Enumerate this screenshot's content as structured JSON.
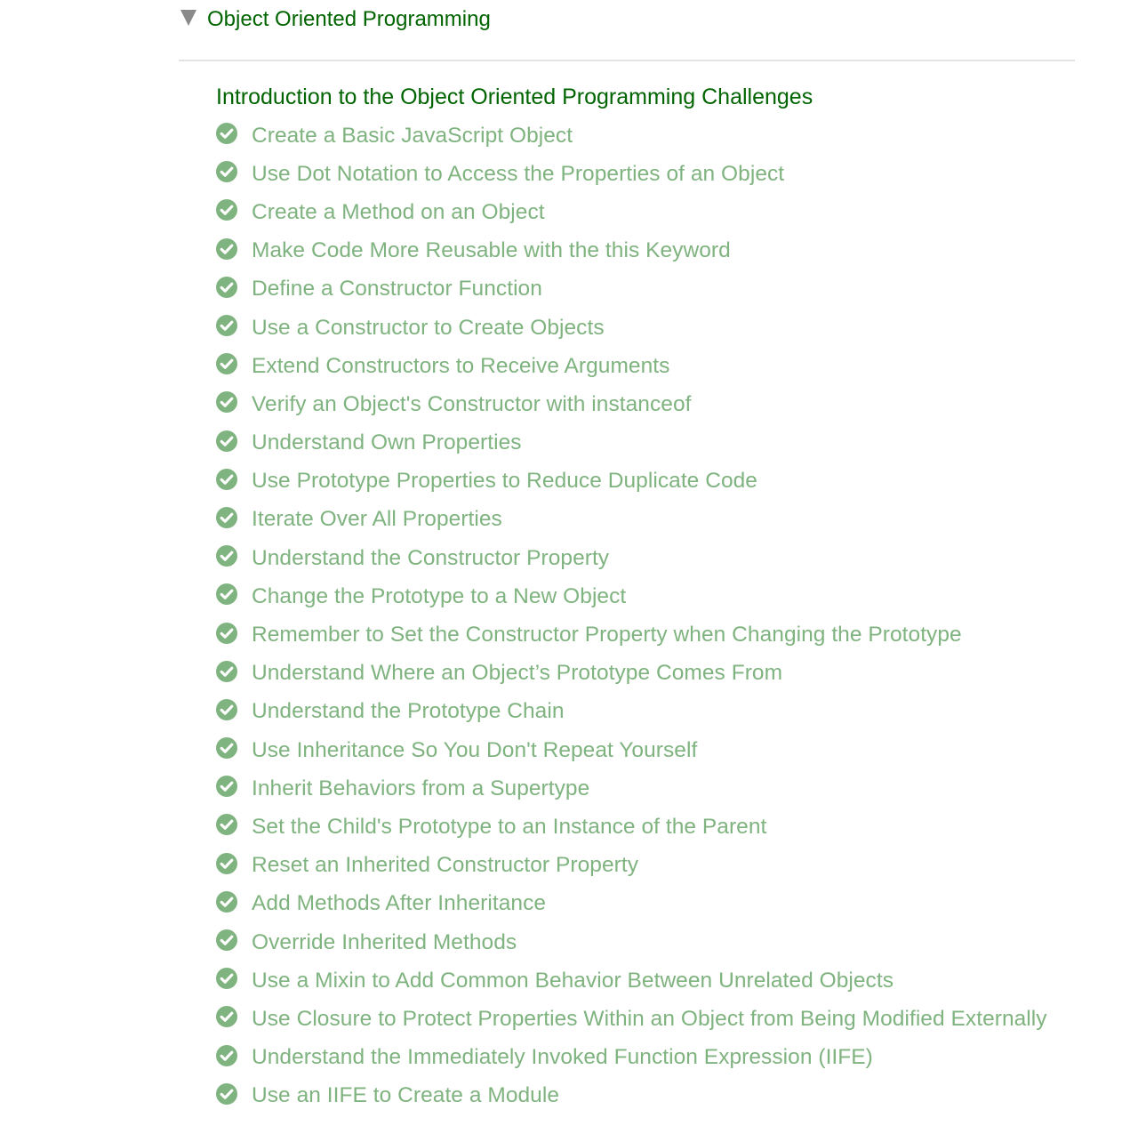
{
  "section": {
    "title": "Object Oriented Programming",
    "expanded_icon": "caret-down-icon",
    "intro_link": "Introduction to the Object Oriented Programming Challenges"
  },
  "colors": {
    "section_title": "#006400",
    "completed_challenge": "#7fb37f",
    "check_icon": "#7fb37f",
    "caret": "#8a8a8a",
    "divider": "#e3e3e3"
  },
  "challenges": [
    {
      "label": "Create a Basic JavaScript Object",
      "completed": true
    },
    {
      "label": "Use Dot Notation to Access the Properties of an Object",
      "completed": true
    },
    {
      "label": "Create a Method on an Object",
      "completed": true
    },
    {
      "label": "Make Code More Reusable with the this Keyword",
      "completed": true
    },
    {
      "label": "Define a Constructor Function",
      "completed": true
    },
    {
      "label": "Use a Constructor to Create Objects",
      "completed": true
    },
    {
      "label": "Extend Constructors to Receive Arguments",
      "completed": true
    },
    {
      "label": "Verify an Object's Constructor with instanceof",
      "completed": true
    },
    {
      "label": "Understand Own Properties",
      "completed": true
    },
    {
      "label": "Use Prototype Properties to Reduce Duplicate Code",
      "completed": true
    },
    {
      "label": "Iterate Over All Properties",
      "completed": true
    },
    {
      "label": "Understand the Constructor Property",
      "completed": true
    },
    {
      "label": "Change the Prototype to a New Object",
      "completed": true
    },
    {
      "label": "Remember to Set the Constructor Property when Changing the Prototype",
      "completed": true
    },
    {
      "label": "Understand Where an Object’s Prototype Comes From",
      "completed": true
    },
    {
      "label": "Understand the Prototype Chain",
      "completed": true
    },
    {
      "label": "Use Inheritance So You Don't Repeat Yourself",
      "completed": true
    },
    {
      "label": "Inherit Behaviors from a Supertype",
      "completed": true
    },
    {
      "label": "Set the Child's Prototype to an Instance of the Parent",
      "completed": true
    },
    {
      "label": "Reset an Inherited Constructor Property",
      "completed": true
    },
    {
      "label": "Add Methods After Inheritance",
      "completed": true
    },
    {
      "label": "Override Inherited Methods",
      "completed": true
    },
    {
      "label": "Use a Mixin to Add Common Behavior Between Unrelated Objects",
      "completed": true
    },
    {
      "label": "Use Closure to Protect Properties Within an Object from Being Modified Externally",
      "completed": true
    },
    {
      "label": "Understand the Immediately Invoked Function Expression (IIFE)",
      "completed": true
    },
    {
      "label": "Use an IIFE to Create a Module",
      "completed": true
    }
  ]
}
